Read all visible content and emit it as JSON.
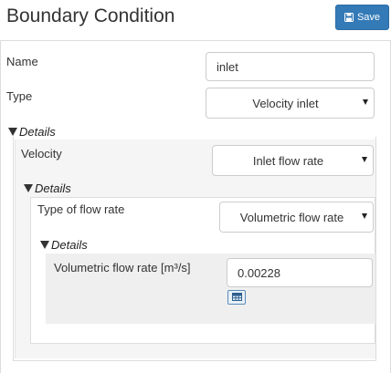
{
  "header": {
    "title": "Boundary Condition",
    "save_label": "Save"
  },
  "form": {
    "name_label": "Name",
    "name_value": "inlet",
    "type_label": "Type",
    "type_value": "Velocity inlet"
  },
  "details1": {
    "heading": "Details",
    "velocity_label": "Velocity",
    "velocity_value": "Inlet flow rate"
  },
  "details2": {
    "heading": "Details",
    "flow_type_label": "Type of flow rate",
    "flow_type_value": "Volumetric flow rate"
  },
  "details3": {
    "heading": "Details",
    "vfr_label": "Volumetric flow rate [m³/s]",
    "vfr_value": "0.00228"
  },
  "icons": {
    "save": "floppy-disk-icon",
    "table": "table-icon",
    "collapse": "triangle-down-icon",
    "dropdown": "caret-down-icon"
  },
  "colors": {
    "primary": "#337ab7"
  }
}
